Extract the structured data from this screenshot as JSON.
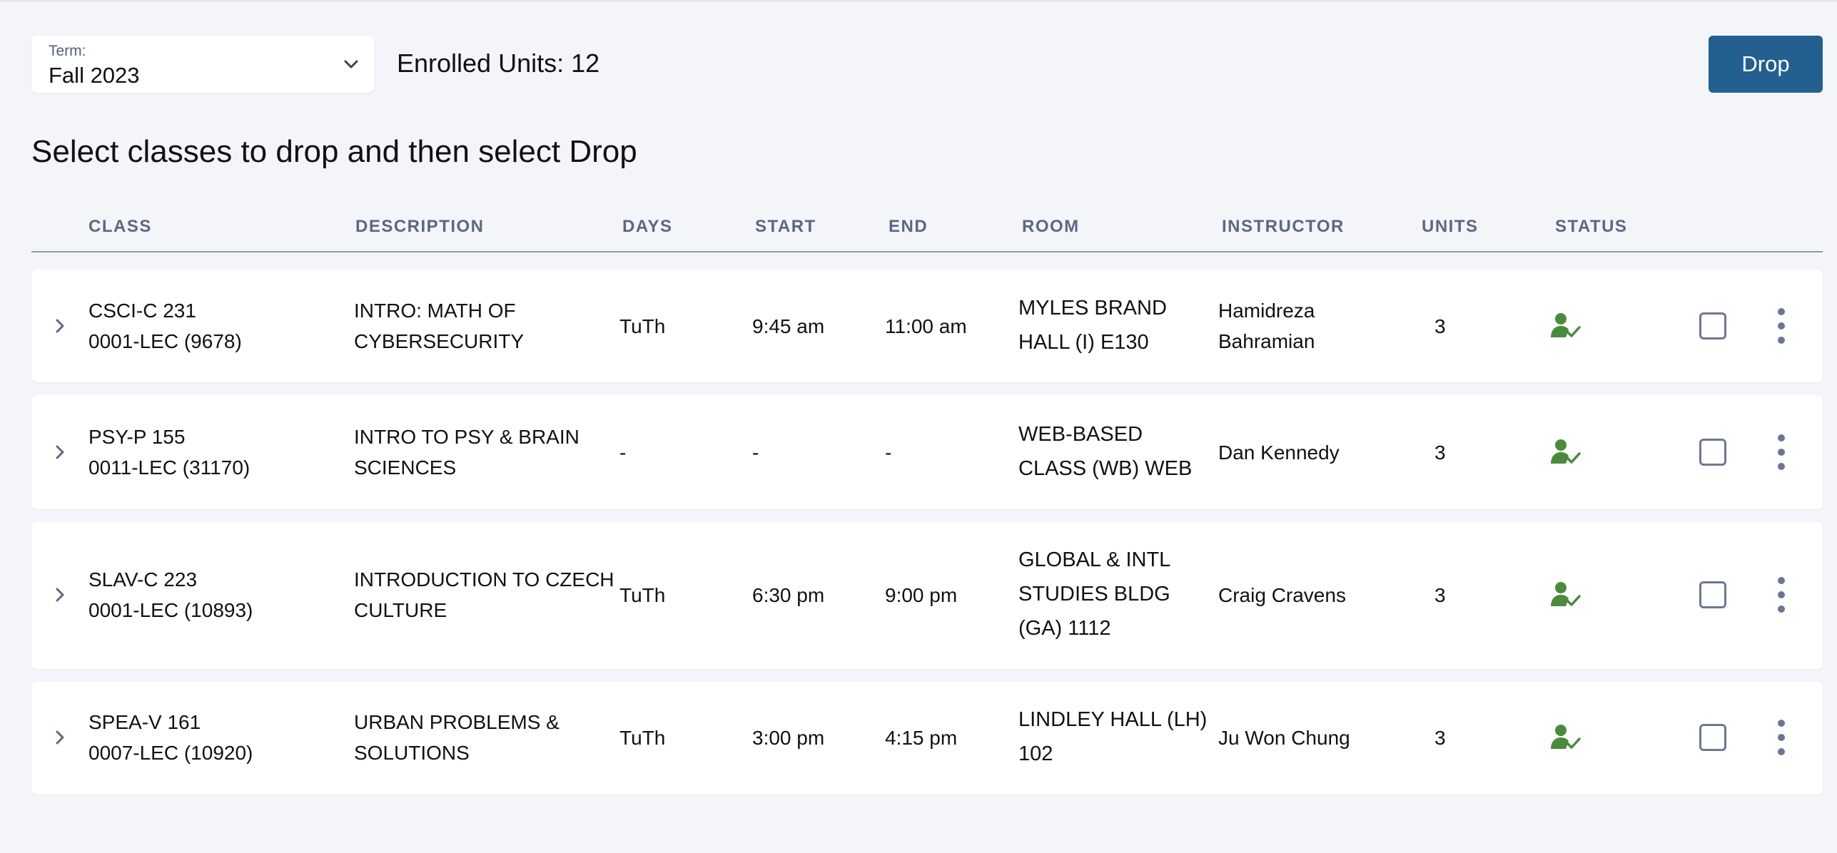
{
  "term": {
    "label": "Term:",
    "value": "Fall 2023"
  },
  "enrolled_units": "Enrolled Units: 12",
  "drop_button": "Drop",
  "heading": "Select classes to drop and then select Drop",
  "columns": [
    "CLASS",
    "DESCRIPTION",
    "DAYS",
    "START",
    "END",
    "ROOM",
    "INSTRUCTOR",
    "UNITS",
    "STATUS"
  ],
  "rows": [
    {
      "class_code": "CSCI-C 231",
      "section": "0001-LEC (9678)",
      "desc1": "INTRO: MATH OF",
      "desc2": "CYBERSECURITY",
      "days": "TuTh",
      "start": "9:45 am",
      "end": "11:00 am",
      "room1": "MYLES BRAND",
      "room2": "HALL (I) E130",
      "room3": "",
      "instructor1": "Hamidreza",
      "instructor2": "Bahramian",
      "units": "3",
      "status": "enrolled-icon"
    },
    {
      "class_code": "PSY-P 155",
      "section": "0011-LEC (31170)",
      "desc1": "INTRO TO PSY & BRAIN",
      "desc2": "SCIENCES",
      "days": "-",
      "start": "-",
      "end": "-",
      "room1": "WEB-BASED",
      "room2": "CLASS (WB) WEB",
      "room3": "",
      "instructor1": "Dan Kennedy",
      "instructor2": "",
      "units": "3",
      "status": "enrolled-icon"
    },
    {
      "class_code": "SLAV-C 223",
      "section": "0001-LEC (10893)",
      "desc1": "INTRODUCTION TO CZECH",
      "desc2": "CULTURE",
      "days": "TuTh",
      "start": "6:30 pm",
      "end": "9:00 pm",
      "room1": "GLOBAL & INTL",
      "room2": "STUDIES BLDG",
      "room3": "(GA) 1112",
      "instructor1": "Craig Cravens",
      "instructor2": "",
      "units": "3",
      "status": "enrolled-icon"
    },
    {
      "class_code": "SPEA-V 161",
      "section": "0007-LEC (10920)",
      "desc1": "URBAN PROBLEMS &",
      "desc2": "SOLUTIONS",
      "days": "TuTh",
      "start": "3:00 pm",
      "end": "4:15 pm",
      "room1": "LINDLEY HALL (LH)",
      "room2": "102",
      "room3": "",
      "instructor1": "Ju Won Chung",
      "instructor2": "",
      "units": "3",
      "status": "enrolled-icon"
    }
  ],
  "colors": {
    "accent": "#24608f",
    "status_green": "#4a8a3c",
    "header_text": "#5d6782"
  }
}
